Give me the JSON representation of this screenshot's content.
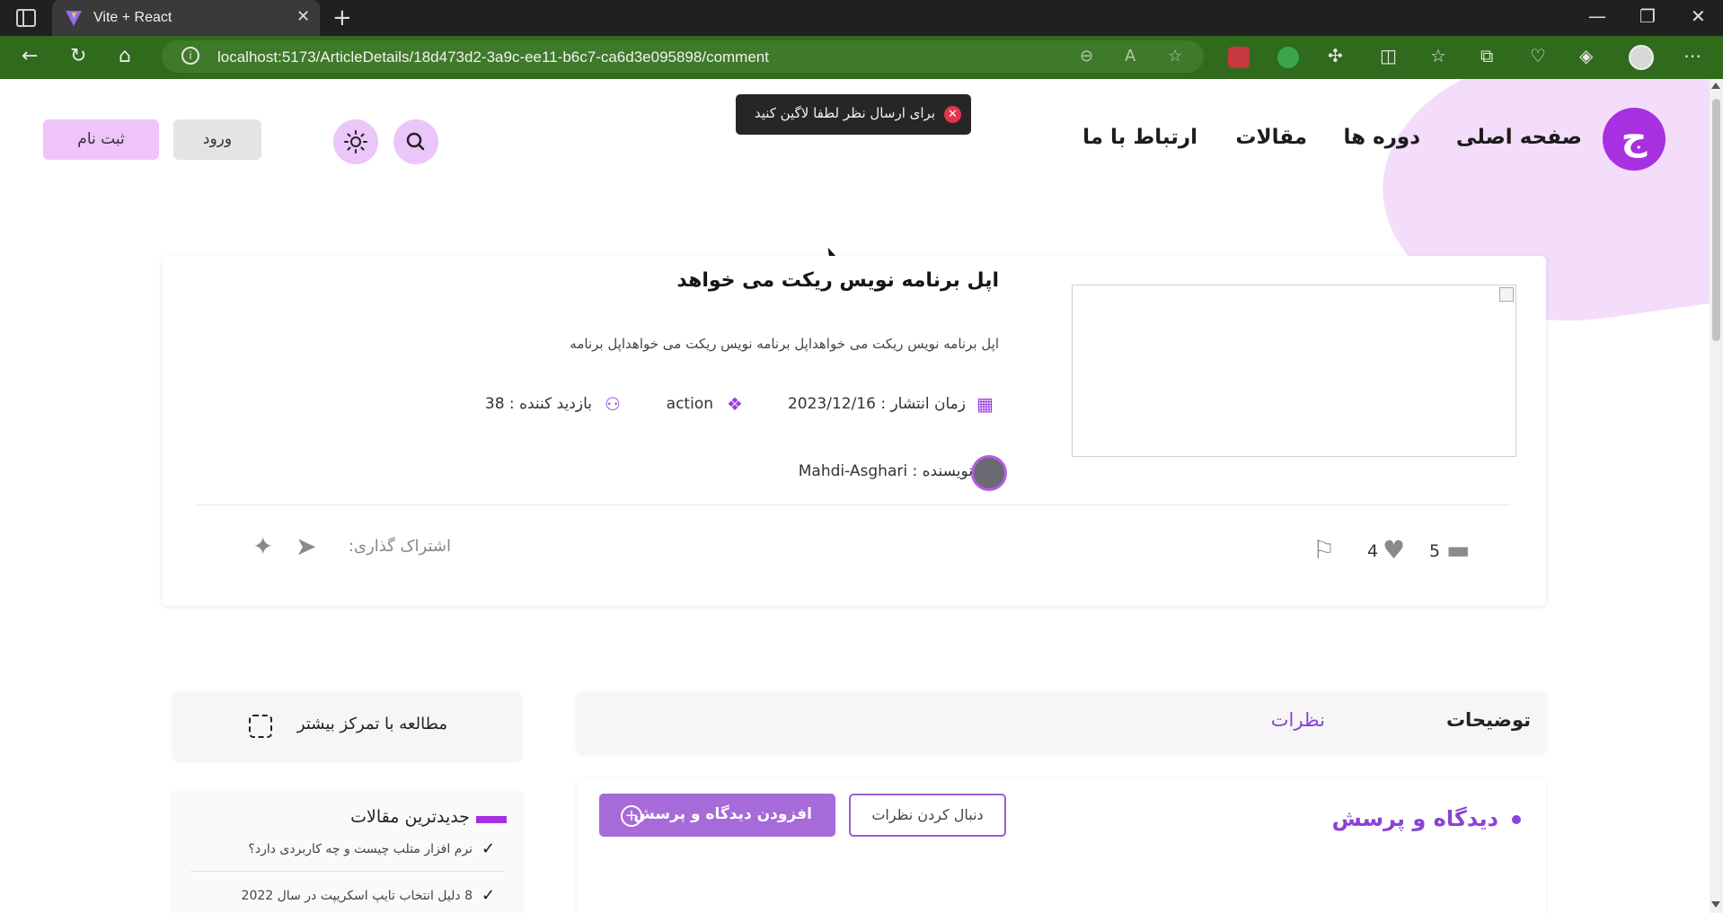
{
  "browser": {
    "tab_title": "Vite + React",
    "url": "localhost:5173/ArticleDetails/18d473d2-3a9c-ee11-b6c7-ca6d3e095898/comment"
  },
  "nav": {
    "logo_glyph": "ج",
    "links": [
      "صفحه اصلی",
      "دوره ها",
      "مقالات",
      "ارتباط با ما"
    ],
    "login_label": "ورود",
    "register_label": "ثبت نام"
  },
  "toast": {
    "message": "برای ارسال نظر لطفا لاگین کنید"
  },
  "article": {
    "title": "اپل برنامه نویس ریکت می خواهد",
    "description": "اپل برنامه نویس ریکت می خواهداپل برنامه نویس ریکت می خواهداپل برنامه",
    "publish_label": "زمان انتشار : 2023/12/16",
    "category": "action",
    "views_label": "بازدید کننده : 38",
    "author_label": "نویسنده : Mahdi-Asghari",
    "share_label": "اشتراک گذاری:",
    "likes": "4",
    "comments": "5"
  },
  "tabs": {
    "description": "توضیحات",
    "comments": "نظرات"
  },
  "comments_section": {
    "heading": "دیدگاه و پرسش",
    "follow_label": "دنبال کردن نظرات",
    "add_label": "افزودن دیدگاه و پرسش"
  },
  "sidebar": {
    "focus_label": "مطالعه با تمرکز بیشتر",
    "latest_title": "جدیدترین مقالات",
    "latest_items": [
      "نرم افزار متلب چیست و چه کاربردی دارد؟",
      "8 دلیل انتخاب تایپ اسکریپت در سال 2022"
    ]
  },
  "colors": {
    "accent": "#a730e0",
    "accent_soft": "#efc4fa",
    "comments_purple": "#8a42d8",
    "toast_error": "#e5354a",
    "address_bar": "#306a1c"
  }
}
